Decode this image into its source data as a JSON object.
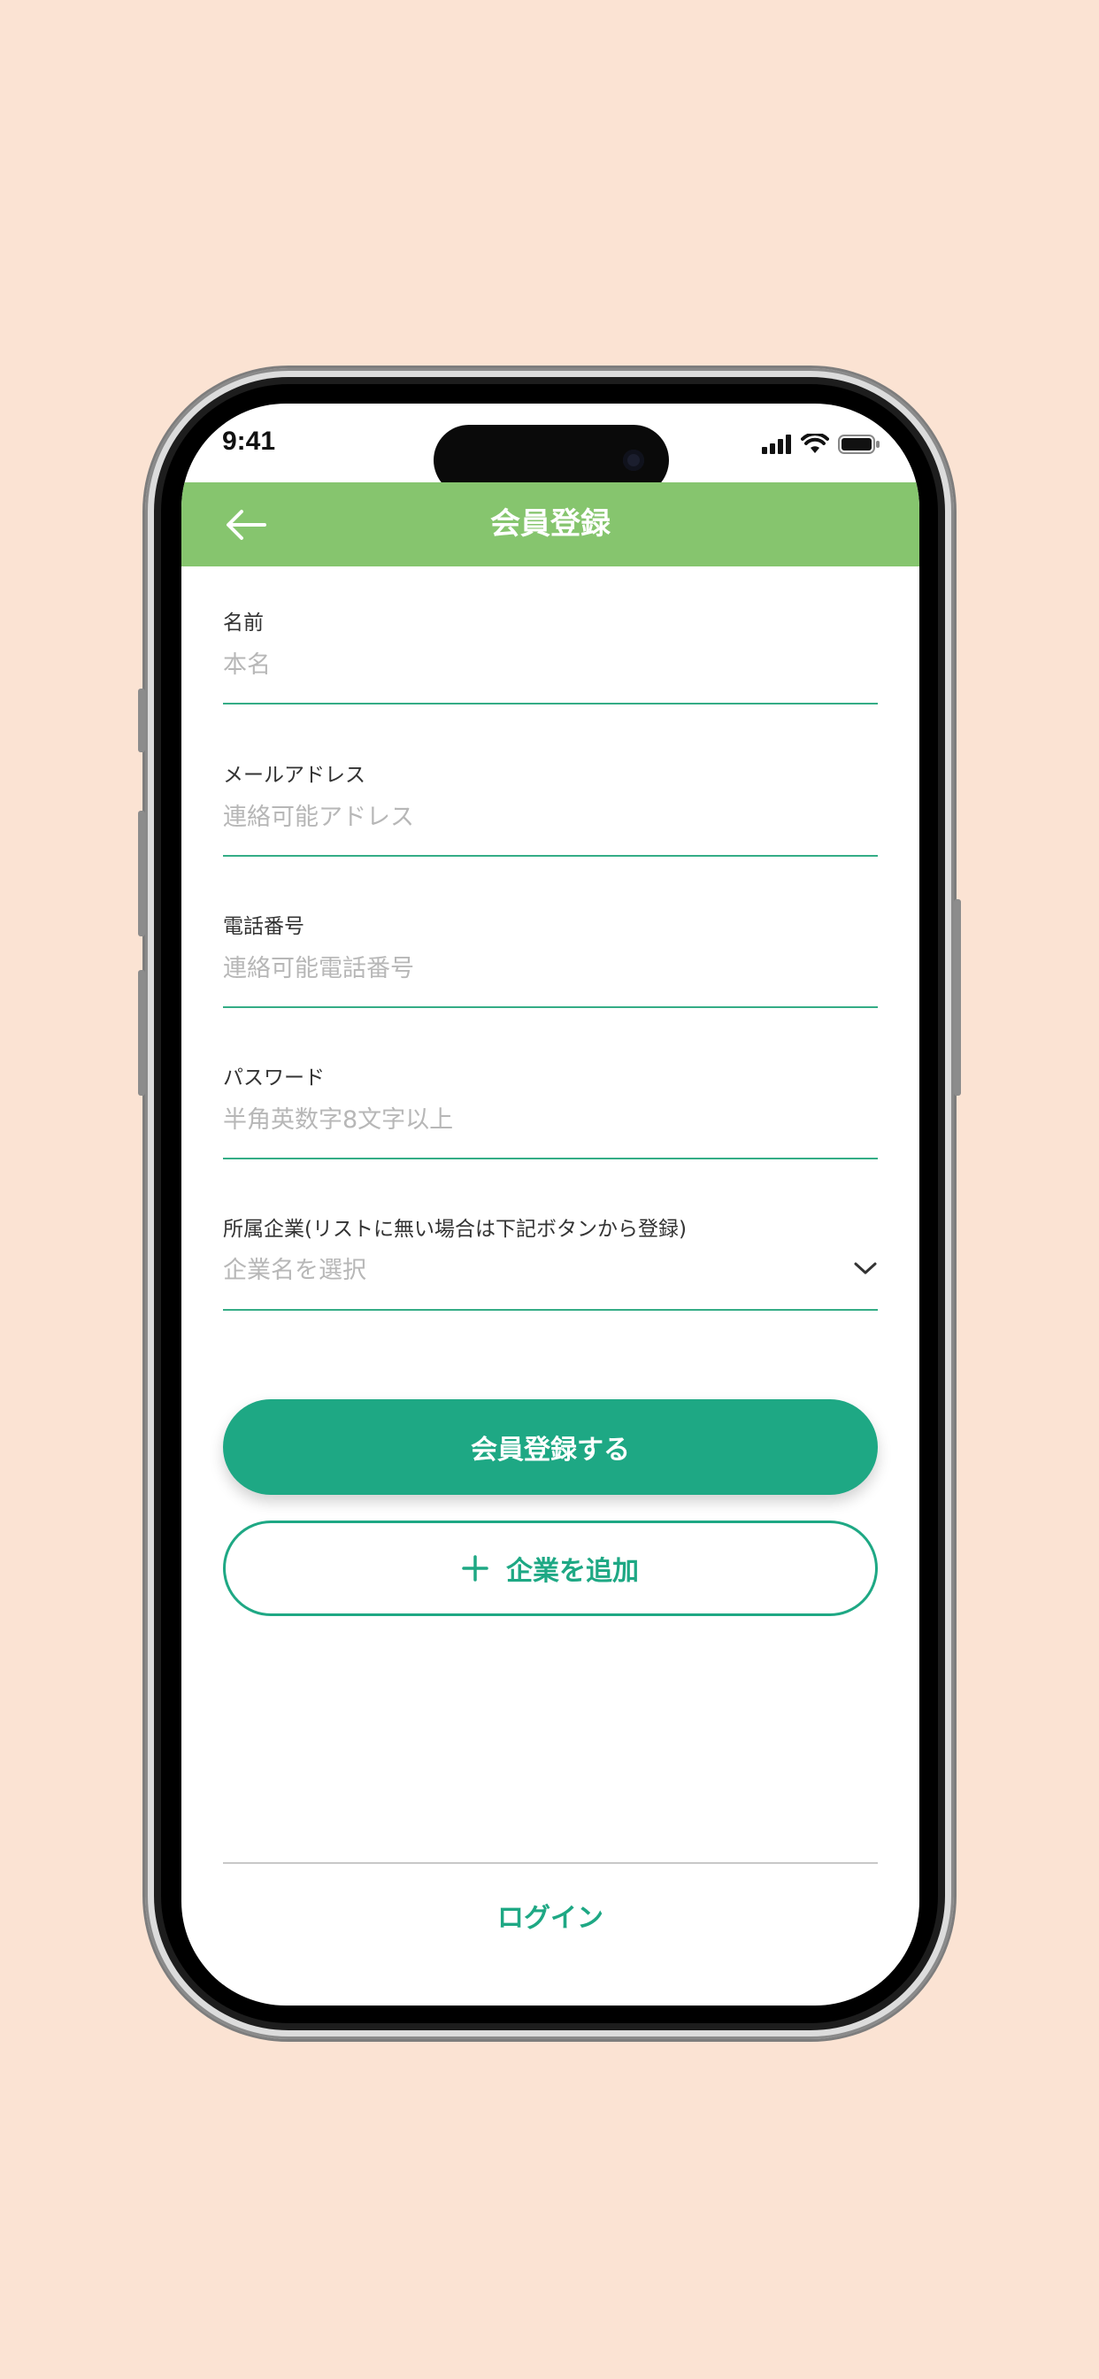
{
  "status_bar": {
    "time": "9:41",
    "icons": [
      "signal-icon",
      "wifi-icon",
      "battery-icon"
    ]
  },
  "header": {
    "title": "会員登録",
    "back_icon": "arrow-left-icon"
  },
  "form": {
    "name": {
      "label": "名前",
      "placeholder": "本名",
      "value": ""
    },
    "email": {
      "label": "メールアドレス",
      "placeholder": "連絡可能アドレス",
      "value": ""
    },
    "phone": {
      "label": "電話番号",
      "placeholder": "連絡可能電話番号",
      "value": ""
    },
    "password": {
      "label": "パスワード",
      "placeholder": "半角英数字8文字以上",
      "value": ""
    },
    "company": {
      "label": "所属企業(リストに無い場合は下記ボタンから登録)",
      "placeholder": "企業名を選択",
      "icon": "chevron-down-icon"
    }
  },
  "actions": {
    "register_label": "会員登録する",
    "add_company_label": "企業を追加",
    "add_company_icon": "plus-icon",
    "login_label": "ログイン"
  },
  "colors": {
    "background": "#fbe3d3",
    "header": "#86c56e",
    "accent": "#1ea884",
    "underline": "#35ad86",
    "placeholder": "#b7b7b7"
  }
}
